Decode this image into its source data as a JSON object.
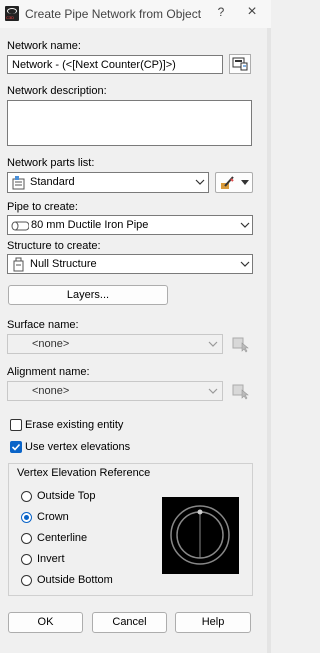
{
  "window": {
    "title": "Create Pipe Network from Object",
    "help": "?",
    "close": "×",
    "app_icon_text": "C3D"
  },
  "network_name": {
    "label": "Network name:",
    "value": "Network - (<[Next Counter(CP)]>)"
  },
  "network_description": {
    "label": "Network description:",
    "value": ""
  },
  "parts_list": {
    "label": "Network parts list:",
    "value": "Standard"
  },
  "pipe": {
    "label": "Pipe to create:",
    "value": "80 mm Ductile Iron Pipe"
  },
  "structure": {
    "label": "Structure to create:",
    "value": "Null Structure"
  },
  "layers_button": "Layers...",
  "surface": {
    "label": "Surface name:",
    "value": "<none>"
  },
  "alignment": {
    "label": "Alignment name:",
    "value": "<none>"
  },
  "checkboxes": {
    "erase": {
      "label": "Erase existing entity",
      "checked": false
    },
    "vertex_elev": {
      "label": "Use vertex elevations",
      "checked": true
    }
  },
  "vertex_ref": {
    "title": "Vertex Elevation Reference",
    "options": [
      {
        "label": "Outside Top",
        "selected": false
      },
      {
        "label": "Crown",
        "selected": true
      },
      {
        "label": "Centerline",
        "selected": false
      },
      {
        "label": "Invert",
        "selected": false
      },
      {
        "label": "Outside Bottom",
        "selected": false
      }
    ]
  },
  "footer": {
    "ok": "OK",
    "cancel": "Cancel",
    "help": "Help"
  },
  "colors": {
    "accent": "#0a64c8",
    "background": "#f0f0f0",
    "preview_bg": "#000000"
  }
}
